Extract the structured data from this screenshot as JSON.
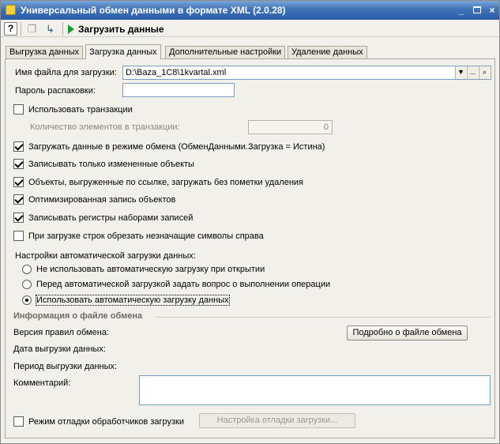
{
  "window": {
    "title": "Универсальный обмен данными в формате XML (2.0.28)",
    "controls": {
      "minimize": "_",
      "close": "×"
    }
  },
  "toolbar": {
    "help_label": "?",
    "run_label": "Загрузить данные"
  },
  "tabs": [
    {
      "label": "Выгрузка данных",
      "active": false
    },
    {
      "label": "Загрузка данных",
      "active": true
    },
    {
      "label": "Дополнительные настройки",
      "active": false
    },
    {
      "label": "Удаление данных",
      "active": false
    }
  ],
  "form": {
    "file_label": "Имя файла для загрузки:",
    "file_value": "D:\\Baza_1C8\\1kvartal.xml",
    "file_dropdown": "▼",
    "file_browse": "...",
    "file_search": "🔍",
    "password_label": "Пароль распаковки:",
    "password_value": "",
    "transactions_label": "Использовать транзакции",
    "transactions_checked": false,
    "tx_count_label": "Количество элементов в транзакции:",
    "tx_count_value": "0",
    "checkboxes": [
      {
        "label": "Загружать данные в режиме обмена (ОбменДанными.Загрузка = Истина)",
        "checked": true
      },
      {
        "label": "Записывать только измененные объекты",
        "checked": true
      },
      {
        "label": "Объекты, выгруженные по ссылке, загружать без пометки удаления",
        "checked": true
      },
      {
        "label": "Оптимизированная запись объектов",
        "checked": true
      },
      {
        "label": "Записывать регистры наборами записей",
        "checked": true
      },
      {
        "label": "При загрузке строк обрезать незначащие символы справа",
        "checked": false
      }
    ],
    "auto_load_label": "Настройки автоматической загрузки данных:",
    "auto_load_options": [
      {
        "label": "Не использовать автоматическую загрузку при открытии",
        "selected": false
      },
      {
        "label": "Перед автоматической загрузкой задать вопрос о выполнении операции",
        "selected": false
      },
      {
        "label": "Использовать автоматическую загрузку данных",
        "selected": true
      }
    ],
    "info_title": "Информация о файле обмена",
    "rules_version_label": "Версия правил обмена:",
    "details_button": "Подробно о файле обмена",
    "export_date_label": "Дата выгрузки данных:",
    "export_period_label": "Период выгрузки данных:",
    "comment_label": "Комментарий:",
    "comment_value": "",
    "debug_label": "Режим отладки обработчиков загрузки",
    "debug_checked": false,
    "debug_settings_button": "Настройка отладки загрузки..."
  },
  "colors": {
    "titlebar": "#3f73b8",
    "window_bg": "#f2f0ea",
    "run_icon": "#1c9a2a",
    "section_title": "#6d6b63"
  }
}
